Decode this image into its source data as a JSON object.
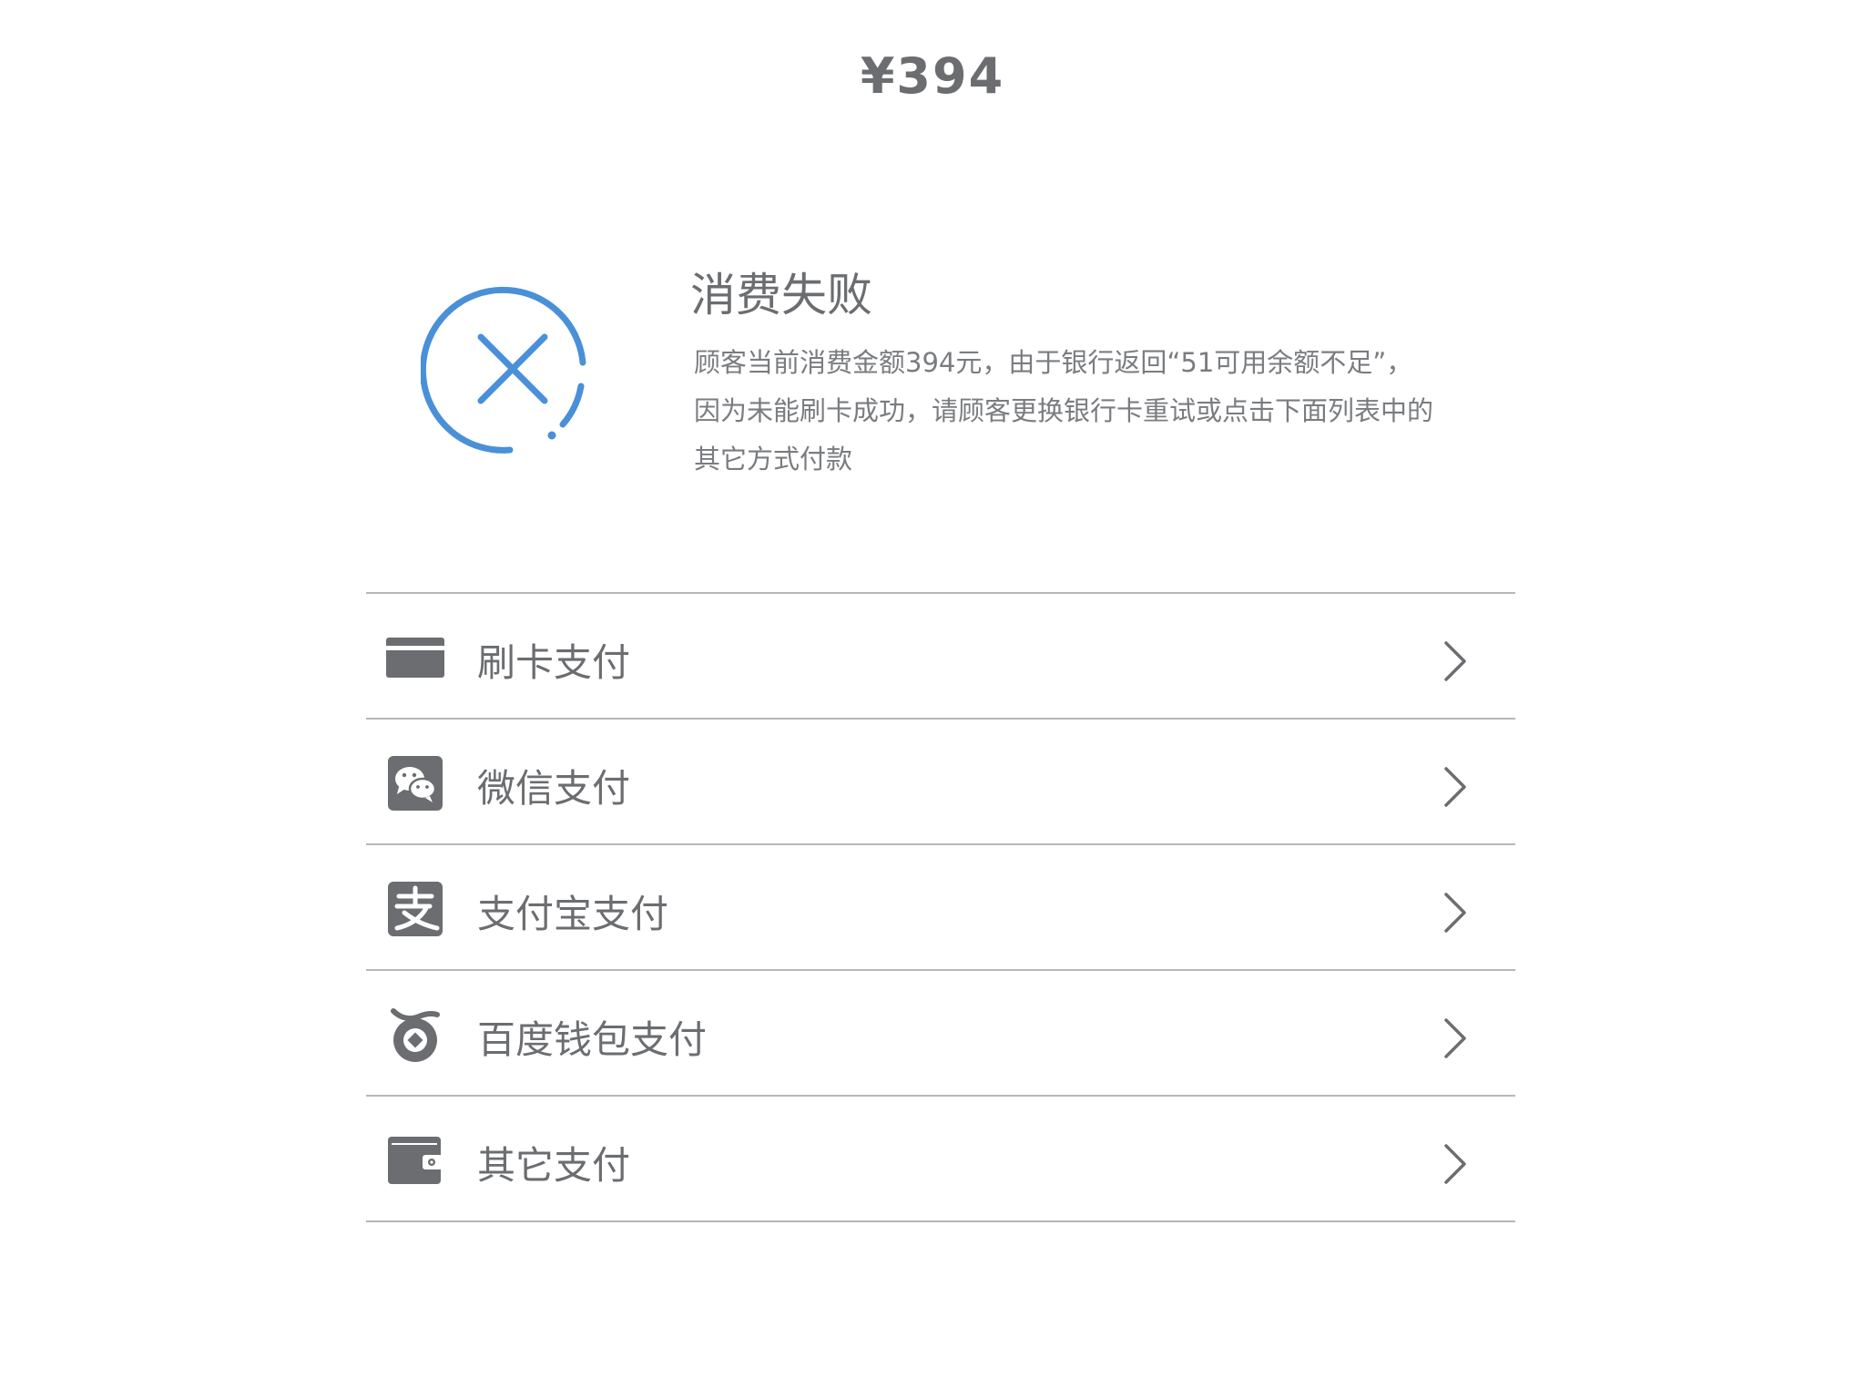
{
  "amount": "¥394",
  "status": {
    "title": "消费失败",
    "description_lines": [
      "顾客当前消费金额394元，由于银行返回“51可用余额不足”，",
      "因为未能刷卡成功，请顾客更换银行卡重试或点击下面列表中的",
      "其它方式付款"
    ],
    "icon": "close-circle-icon",
    "icon_color": "#4a90d9"
  },
  "payment_methods": [
    {
      "label": "刷卡支付",
      "icon": "bank-card-icon"
    },
    {
      "label": "微信支付",
      "icon": "wechat-icon"
    },
    {
      "label": "支付宝支付",
      "icon": "alipay-icon"
    },
    {
      "label": "百度钱包支付",
      "icon": "baidu-wallet-icon"
    },
    {
      "label": "其它支付",
      "icon": "wallet-icon"
    }
  ],
  "colors": {
    "text": "#6b6d70",
    "divider": "#b5b7ba",
    "icon_fill": "#6b6d70"
  }
}
